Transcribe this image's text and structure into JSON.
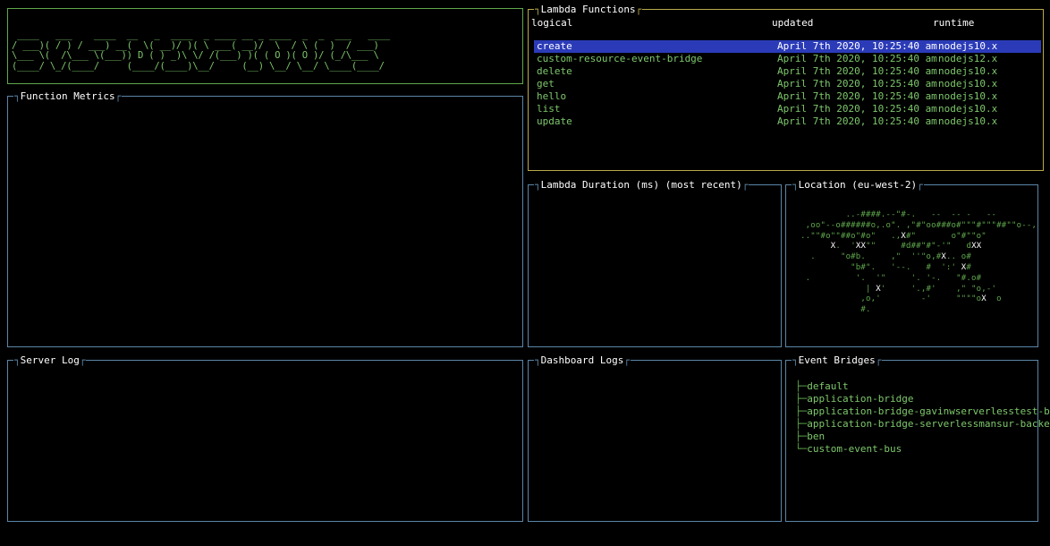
{
  "banner": {
    "art": " ____   ___    ____  __   _  ____  _ ____ __ _ ____  _  _  ___   ____ \n/ ___)( / ) / ___) __(  \\( __)/ )( \\ ___( __)/  \\  / \\ (  )  / ___)\n\\___ \\(  /\\___ \\(___)) D ( ) _)\\ \\/ /(___) )( ( O )( O )/ (_/\\___ \\\n(____/ \\_/(____/     (____/(____)\\__/     (__) \\__/ \\__/ \\____(____/"
  },
  "metrics": {
    "title": "Function Metrics"
  },
  "lambda": {
    "title": "Lambda Functions",
    "headers": {
      "logical": "logical",
      "updated": "updated",
      "runtime": "runtime"
    },
    "rows": [
      {
        "name": "create",
        "updated": "April 7th 2020, 10:25:40 am",
        "runtime": "nodejs10.x"
      },
      {
        "name": "custom-resource-event-bridge",
        "updated": "April 7th 2020, 10:25:40 am",
        "runtime": "nodejs12.x"
      },
      {
        "name": "delete",
        "updated": "April 7th 2020, 10:25:40 am",
        "runtime": "nodejs10.x"
      },
      {
        "name": "get",
        "updated": "April 7th 2020, 10:25:40 am",
        "runtime": "nodejs10.x"
      },
      {
        "name": "hello",
        "updated": "April 7th 2020, 10:25:40 am",
        "runtime": "nodejs10.x"
      },
      {
        "name": "list",
        "updated": "April 7th 2020, 10:25:40 am",
        "runtime": "nodejs10.x"
      },
      {
        "name": "update",
        "updated": "April 7th 2020, 10:25:40 am",
        "runtime": "nodejs10.x"
      }
    ]
  },
  "duration": {
    "title": "Lambda Duration (ms) (most recent)"
  },
  "location": {
    "title": "Location (eu-west-2)",
    "map": "         ..-####.--\"#-.   --  -- -   --\n ,oo\"--o######o,.o\". ,\"#\"oo###o#\"\"\"#\"\"\"##\"\"o--,\n..\"\"#o\"\"##o\"#o\"   .,X#\"       o\"#\"\"o\"\n      X.  'XX\"\"     #d##\"#\"-'\"   dXX\n  .     \"o#b.     ,\"  ''\"o,#X.. o#\n          \"b#\".   '--.   #  ':' X#\n .         '.  '\"     '. '-.   \"#.o#\n             | X'     '.,#'    ,\" \"o,-'\n            ,o,'        -'     \"\"\"\"oX  o\n            #."
  },
  "server_log": {
    "title": "Server Log"
  },
  "dashboard_logs": {
    "title": "Dashboard Logs"
  },
  "event_bridges": {
    "title": "Event Bridges",
    "items": [
      "default",
      "application-bridge",
      "application-bridge-gavinwserverlesstest-bac",
      "application-bridge-serverlessmansur-backend",
      "ben",
      "custom-event-bus"
    ]
  },
  "colors": {
    "accent_green": "#7ec86c",
    "border_blue": "#5b86a8",
    "border_green": "#5fa84c",
    "border_yellow": "#b8a94a",
    "selection_blue": "#2b3bb8"
  }
}
